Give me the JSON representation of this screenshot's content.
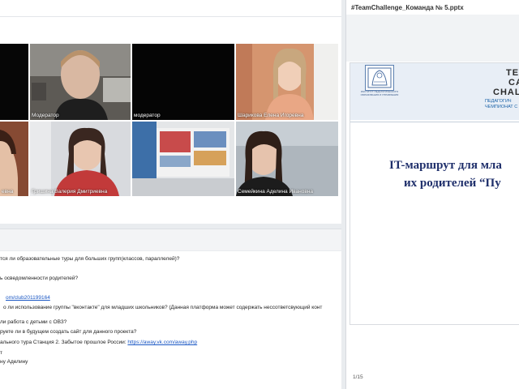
{
  "presentation": {
    "file_title": "#TeamChallenge_Команда № 5.pptx",
    "slide": {
      "brand_lines": [
        "TEA",
        "CAL",
        "CHAL"
      ],
      "subtitle_lines": [
        "ПЕДАГОГИЧ",
        "ЧЕМПИОНАТ С"
      ],
      "logo_caption": "ИНСТИТУТ ПЕДАГОГИЧЕСКОГО ОБРАЗОВАНИЯ И УПРАВЛЕНИЯ",
      "heading_line1": "IT-маршрут для мла",
      "heading_line2": "их родителей “Пу"
    },
    "page_indicator": "1/15"
  },
  "participants": [
    {
      "name": ""
    },
    {
      "name": "Модератор"
    },
    {
      "name": "модератор"
    },
    {
      "name": "Шарикова Елена  Игоревна"
    },
    {
      "name": "евна"
    },
    {
      "name": "Гришина Валерия  Дмитриевна"
    },
    {
      "name": ""
    },
    {
      "name": "Семейкина Аделина Ивановна"
    }
  ],
  "chat": {
    "lines": [
      {
        "text": "тся ли образовательные туры для больших групп(классов, параллелей)?"
      },
      {
        "text": "ь осведомленности родителей?"
      },
      {
        "text": "om/club201199164",
        "link": true
      },
      {
        "text": "о ли использование группы  \"вконтакте\" для младших школьников? (Данная платформа может содержать нессответсвующий конт"
      },
      {
        "text": "ли работа с детьми с ОВЗ?"
      },
      {
        "text": "руете ли в будущем создать сайт для данного проекта?"
      },
      {
        "text_before": "ального тура Станция 2. Забытое прошлое России: ",
        "link_text": "https://away.vk.com/away.php"
      },
      {
        "text": "т"
      },
      {
        "text": "ну Аделину"
      }
    ]
  }
}
